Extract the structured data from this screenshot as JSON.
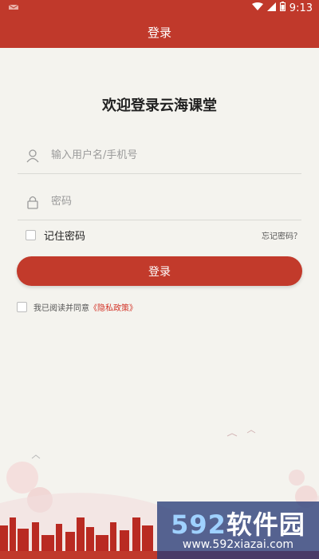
{
  "status_bar": {
    "time": "9:13"
  },
  "app_bar": {
    "title": "登录"
  },
  "welcome": "欢迎登录云海课堂",
  "username": {
    "placeholder": "输入用户名/手机号",
    "value": ""
  },
  "password": {
    "placeholder": "密码",
    "value": ""
  },
  "remember": {
    "label": "记住密码",
    "checked": false
  },
  "forgot_password": "忘记密码？",
  "login_button": "登录",
  "agreement": {
    "prefix": "我已阅读并同意",
    "policy_link": "《隐私政策》",
    "checked": false
  },
  "watermark": {
    "number": "592",
    "brand": "软件园",
    "url": "www.592xiazai.com"
  },
  "colors": {
    "primary": "#c0392b",
    "background": "#f4f3ee",
    "policy_link": "#d3362a"
  },
  "icons": [
    "mail-icon",
    "wifi-icon",
    "signal-icon",
    "battery-icon",
    "user-icon",
    "lock-icon"
  ]
}
